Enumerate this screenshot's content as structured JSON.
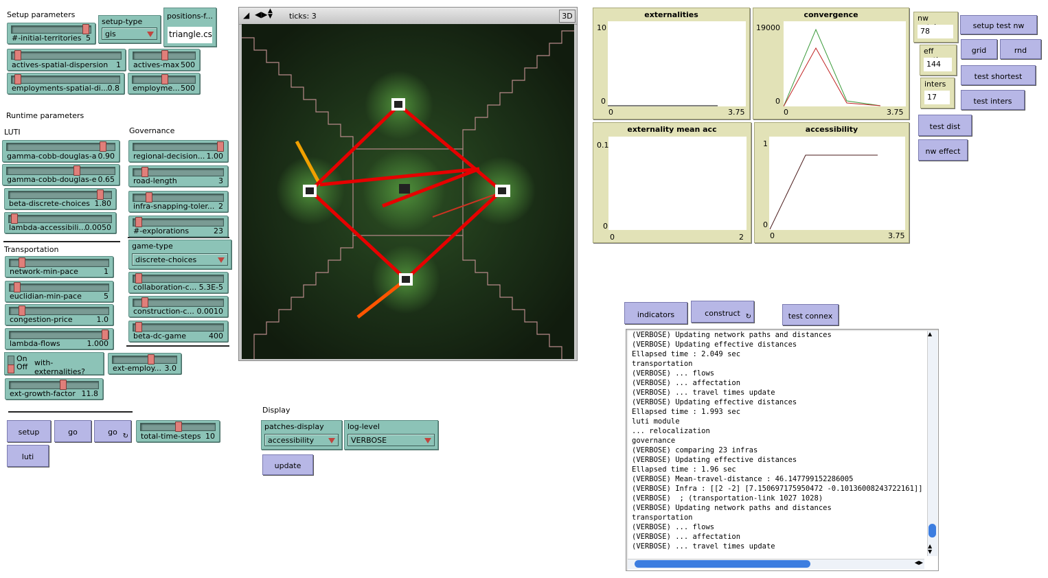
{
  "sections": {
    "setup": "Setup parameters",
    "runtime": "Runtime parameters",
    "luti": "LUTI",
    "governance": "Governance",
    "transportation": "Transportation",
    "display": "Display"
  },
  "sliders": {
    "initial_territories": {
      "name": "#-initial-territories",
      "value": "5",
      "level": 0.95
    },
    "actives_spatial_dispersion": {
      "name": "actives-spatial-dispersion",
      "value": "1",
      "level": 0.03
    },
    "actives_max": {
      "name": "actives-max",
      "value": "500",
      "level": 0.5
    },
    "employments_spatial": {
      "name": "employments-spatial-di...",
      "value": "0.8",
      "level": 0.03
    },
    "employments_max": {
      "name": "employme...",
      "value": "500",
      "level": 0.5
    },
    "gamma_a": {
      "name": "gamma-cobb-douglas-a",
      "value": "0.90",
      "level": 0.9
    },
    "gamma_e": {
      "name": "gamma-cobb-douglas-e",
      "value": "0.65",
      "level": 0.65
    },
    "beta_discrete": {
      "name": "beta-discrete-choices",
      "value": "1.80",
      "level": 0.9
    },
    "lambda_access": {
      "name": "lambda-accessibili...",
      "value": "0.0050",
      "level": 0.03
    },
    "regional_decision": {
      "name": "regional-decision...",
      "value": "1.00",
      "level": 0.98
    },
    "road_length": {
      "name": "road-length",
      "value": "3",
      "level": 0.1
    },
    "infra_snapping": {
      "name": "infra-snapping-toler...",
      "value": "2",
      "level": 0.15
    },
    "explorations": {
      "name": "#-explorations",
      "value": "23",
      "level": 0.03
    },
    "network_min_pace": {
      "name": "network-min-pace",
      "value": "1",
      "level": 0.1
    },
    "euclidian_min_pace": {
      "name": "euclidian-min-pace",
      "value": "5",
      "level": 0.05
    },
    "congestion_price": {
      "name": "congestion-price",
      "value": "1.0",
      "level": 0.1
    },
    "lambda_flows": {
      "name": "lambda-flows",
      "value": "1.000",
      "level": 0.98
    },
    "collaboration_cost": {
      "name": "collaboration-c...",
      "value": "5.3E-5",
      "level": 0.03
    },
    "construction_cost": {
      "name": "construction-c...",
      "value": "0.0010",
      "level": 0.1
    },
    "beta_dc_game": {
      "name": "beta-dc-game",
      "value": "400",
      "level": 0.03
    },
    "ext_employ": {
      "name": "ext-employ...",
      "value": "3.0",
      "level": 0.6
    },
    "ext_growth_factor": {
      "name": "ext-growth-factor",
      "value": "11.8",
      "level": 0.6
    },
    "total_time_steps": {
      "name": "total-time-steps",
      "value": "10",
      "level": 0.5
    }
  },
  "choosers": {
    "setup_type": {
      "title": "setup-type",
      "value": "gis"
    },
    "game_type": {
      "title": "game-type",
      "value": "discrete-choices"
    },
    "patches_display": {
      "title": "patches-display",
      "value": "accessibility"
    },
    "log_level": {
      "title": "log-level",
      "value": "VERBOSE"
    }
  },
  "inputs": {
    "positions_file": {
      "title": "positions-f...",
      "value": "triangle.csv"
    }
  },
  "switch": {
    "on": "On",
    "off": "Off",
    "name": "with-externalities?"
  },
  "buttons": {
    "setup": "setup",
    "go": "go",
    "go_forever": "go",
    "luti": "luti",
    "update": "update",
    "setup_test_nw": "setup test nw",
    "grid": "grid",
    "rnd": "rnd",
    "test_shortest": "test shortest",
    "test_inters": "test inters",
    "test_dist": "test dist",
    "nw_effect": "nw effect",
    "indicators": "indicators",
    "construct": "construct",
    "test_connex": "test connex"
  },
  "monitors": {
    "nw_patches": {
      "title": "nw patches",
      "value": "78"
    },
    "eff_paths": {
      "title": "eff paths",
      "value": "144"
    },
    "inters": {
      "title": "inters",
      "value": "17"
    }
  },
  "world": {
    "ticks": "ticks: 3",
    "three_d": "3D"
  },
  "plots": {
    "externalities": {
      "title": "externalities",
      "ymax": "10",
      "ymin": "0",
      "xmin": "0",
      "xmax": "3.75"
    },
    "convergence": {
      "title": "convergence",
      "ymax": "19000",
      "ymin": "0",
      "xmin": "0",
      "xmax": "3.75"
    },
    "externality_mean_acc": {
      "title": "externality mean acc",
      "ymax": "0.1",
      "ymin": "0",
      "xmin": "0",
      "xmax": "2"
    },
    "accessibility": {
      "title": "accessibility",
      "ymax": "1",
      "ymin": "0",
      "xmin": "0",
      "xmax": "3.75"
    }
  },
  "colors": {
    "slider": "#8cc3b7",
    "button": "#b7b7e6",
    "monitor": "#e2e2b7",
    "road": "#e60000",
    "knob": "#e07f7a"
  },
  "console_lines": [
    "(VERBOSE) Updating network paths and distances",
    "(VERBOSE) Updating effective distances",
    "Ellapsed time : 2.049 sec",
    "transportation",
    "(VERBOSE) ... flows",
    "(VERBOSE) ... affectation",
    "(VERBOSE) ... travel times update",
    "(VERBOSE) Updating effective distances",
    "Ellapsed time : 1.993 sec",
    "luti module",
    "... relocalization",
    "governance",
    "(VERBOSE) comparing 23 infras",
    "(VERBOSE) Updating effective distances",
    "Ellapsed time : 1.96 sec",
    "(VERBOSE) Mean-travel-distance : 46.147799152286005",
    "(VERBOSE) Infra : [[2 -2] [7.150697175950472 -0.10136008243722161]]",
    "(VERBOSE)  ; (transportation-link 1027 1028)",
    "(VERBOSE) Updating network paths and distances",
    "transportation",
    "(VERBOSE) ... flows",
    "(VERBOSE) ... affectation",
    "(VERBOSE) ... travel times update"
  ]
}
